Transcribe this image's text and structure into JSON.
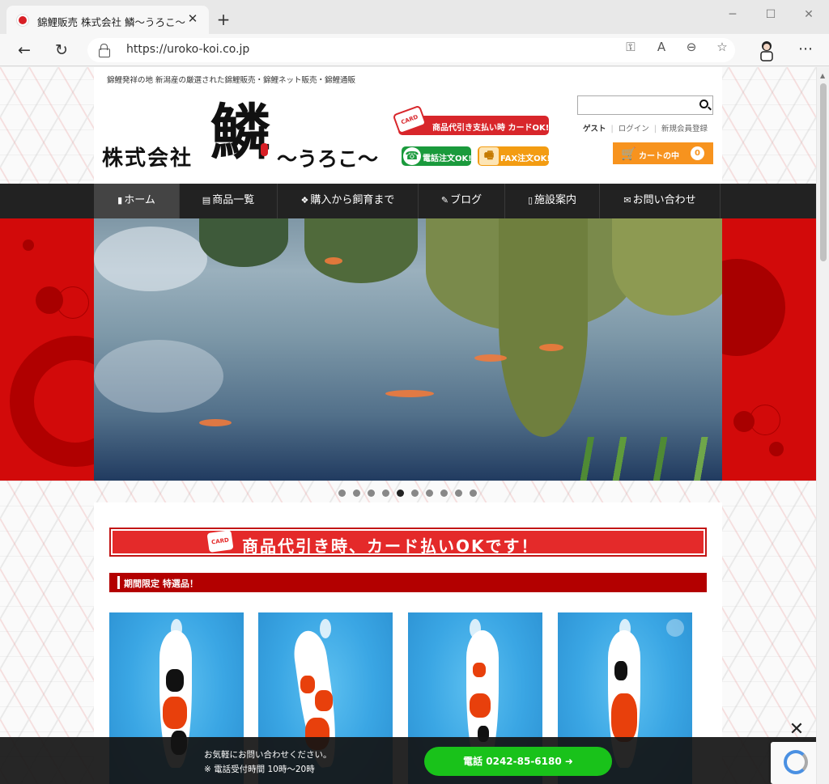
{
  "browser": {
    "tab_title": "錦鯉販売 株式会社 鱗～うろこ～",
    "url": "https://uroko-koi.co.jp",
    "icons": [
      "back-icon",
      "refresh-icon",
      "lock-icon",
      "key-icon",
      "read-aloud-icon",
      "zoom-out-icon",
      "favorites-icon",
      "profile-icon",
      "more-icon"
    ]
  },
  "header": {
    "tagline": "錦鯉発祥の地 新潟産の厳選された錦鯉販売・錦鯉ネット販売・錦鯉通販",
    "logo": {
      "company": "株式会社",
      "kanji": "鱗",
      "reading": "～うろこ～"
    },
    "badges": {
      "card": "商品代引き支払い時 カードOK!",
      "card_icon": "CARD",
      "tel": "電話注文OK!",
      "fax": "FAX注文OK!"
    },
    "account": {
      "guest": "ゲスト",
      "login": "ログイン",
      "register": "新規会員登録"
    },
    "cart": {
      "label": "カートの中",
      "count": "0"
    }
  },
  "nav": {
    "items": [
      {
        "label": "ホーム",
        "icon": "bookmark-icon"
      },
      {
        "label": "商品一覧",
        "icon": "list-icon"
      },
      {
        "label": "購入から飼育まで",
        "icon": "cubes-icon"
      },
      {
        "label": "ブログ",
        "icon": "edit-icon"
      },
      {
        "label": "施設案内",
        "icon": "building-icon"
      },
      {
        "label": "お問い合わせ",
        "icon": "mail-icon"
      }
    ]
  },
  "slider": {
    "dot_count": 10,
    "active_index": 4
  },
  "main": {
    "card_banner": "商品代引き時、カード払いOKです！",
    "card_banner_icon": "CARD",
    "section_title": "期間限定 特選品！"
  },
  "footer_bar": {
    "line1": "お気軽にお問い合わせください。",
    "line2": "※ 電話受付時間 10時～20時",
    "phone_button": "電話 0242-85-6180 ➜"
  },
  "colors": {
    "brand_red": "#d20a0a",
    "nav_bg": "#222222",
    "cart_orange": "#f7931e",
    "phone_green": "#19c21a"
  }
}
